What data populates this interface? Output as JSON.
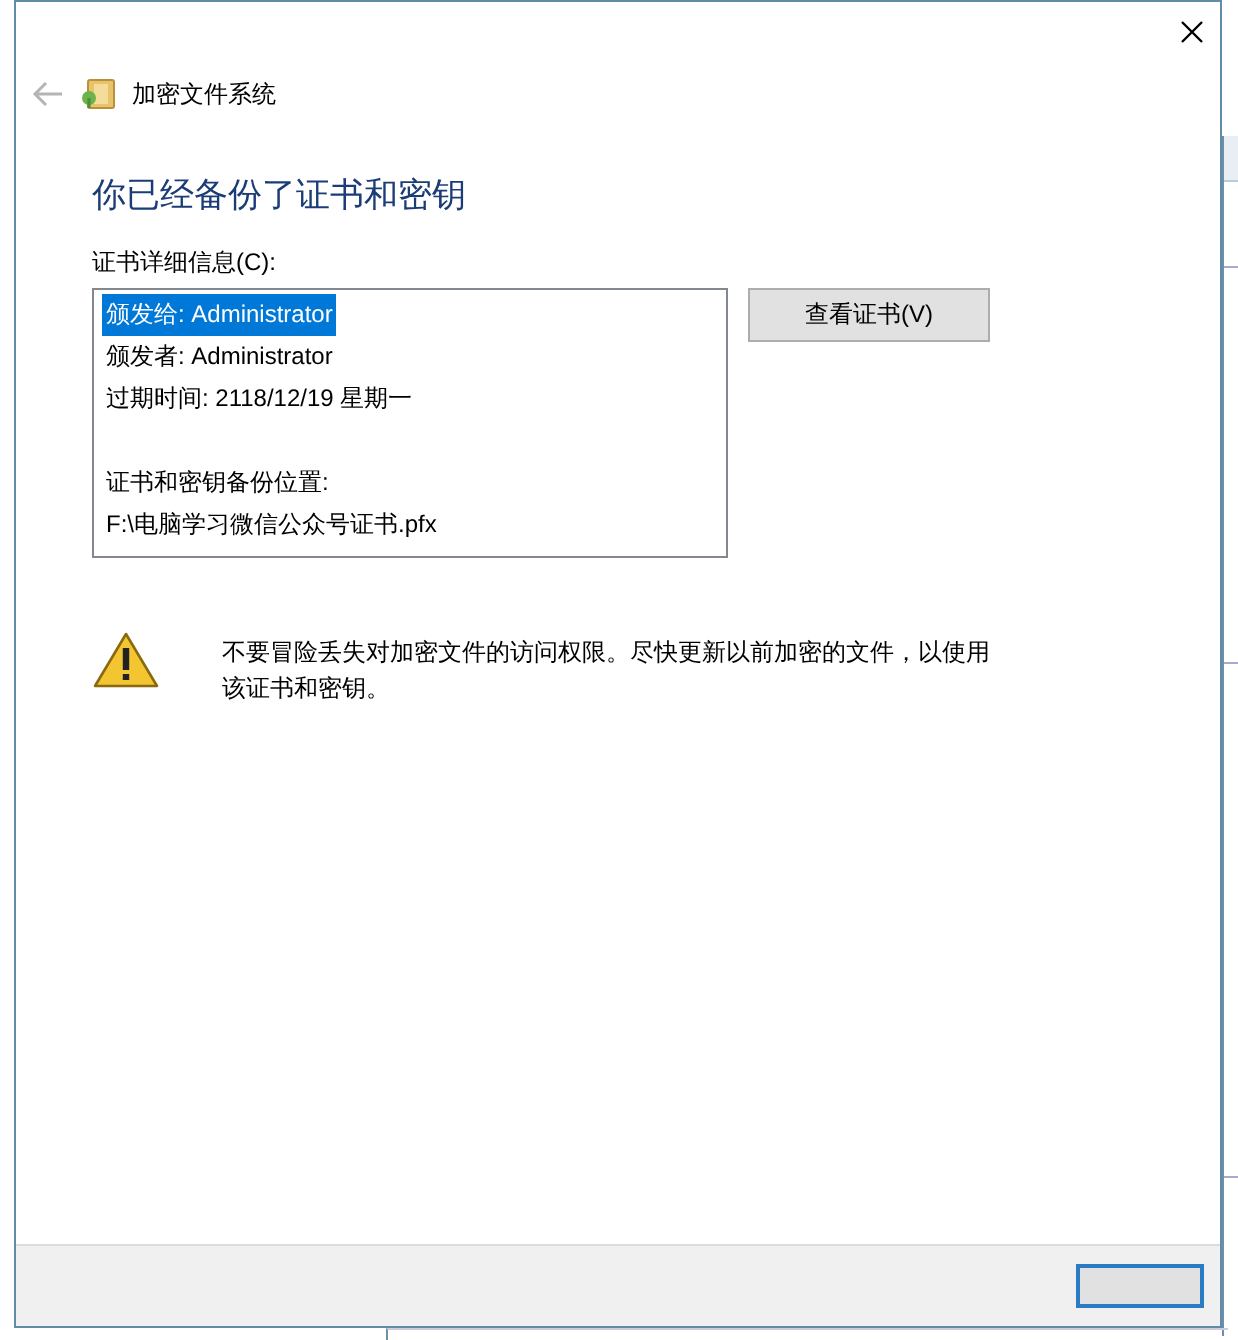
{
  "window": {
    "title": "加密文件系统"
  },
  "heading": "你已经备份了证书和密钥",
  "details": {
    "label": "证书详细信息(C):",
    "sections": [
      {
        "lines": [
          {
            "text": "颁发给: Administrator",
            "selected": true
          },
          {
            "text": "颁发者: Administrator",
            "selected": false
          },
          {
            "text": "过期时间: 2118/12/19 星期一",
            "selected": false
          }
        ]
      },
      {
        "lines": [
          {
            "text": "证书和密钥备份位置:",
            "selected": false
          },
          {
            "text": "F:\\电脑学习微信公众号证书.pfx",
            "selected": false
          }
        ]
      }
    ]
  },
  "view_button": "查看证书(V)",
  "warning": "不要冒险丢失对加密文件的访问权限。尽快更新以前加密的文件，以使用该证书和密钥。"
}
